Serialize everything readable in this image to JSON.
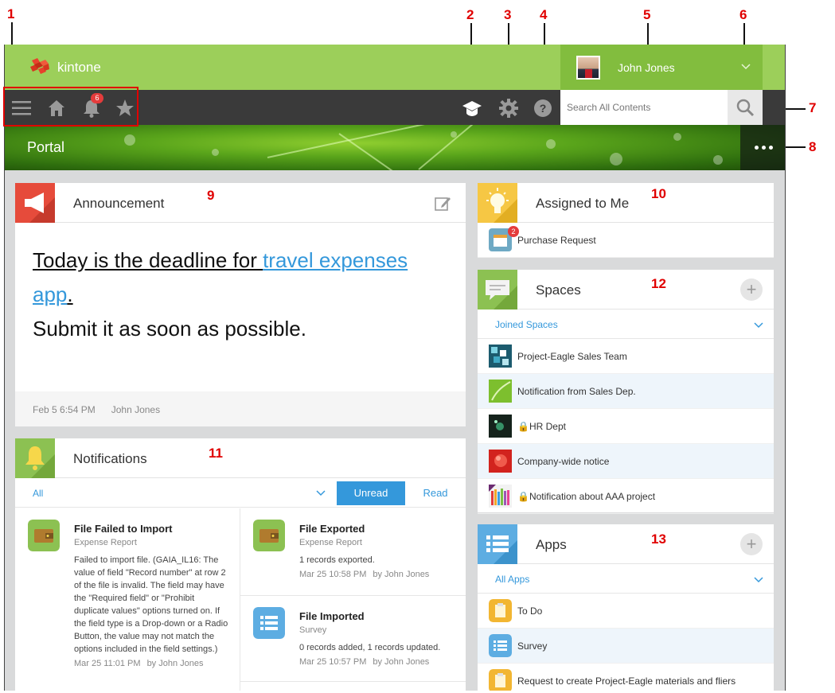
{
  "callouts": [
    "1",
    "2",
    "3",
    "4",
    "5",
    "6",
    "7",
    "8",
    "9",
    "10",
    "11",
    "12",
    "13"
  ],
  "header": {
    "logo_text": "kintone",
    "user_name": "John Jones",
    "notification_count": "6",
    "search_placeholder": "Search All Contents",
    "brand_green": "#9ccf5a",
    "toolbar_dark": "#3a3a3a"
  },
  "banner": {
    "title": "Portal"
  },
  "announcement": {
    "title": "Announcement",
    "text_part1": "Today is the deadline for ",
    "link_text": "travel expenses app",
    "text_part2": ".",
    "line2": "Submit it as soon as possible.",
    "date": "Feb 5 6:54 PM",
    "author": "John Jones"
  },
  "notifications": {
    "title": "Notifications",
    "filter": "All",
    "unread_label": "Unread",
    "read_label": "Read",
    "items": [
      {
        "title": "File Failed to Import",
        "app": "Expense Report",
        "body": "Failed to import file. (GAIA_IL16: The value of field \"Record number\" at row 2 of the file is invalid. The field may have the \"Required field\" or \"Prohibit duplicate values\" options turned on. If the field type is a Drop-down or a Radio Button, the value may not match the options included in the field settings.)",
        "date": "Mar 25 11:01 PM",
        "by": "by John Jones"
      },
      {
        "title": "File Exported",
        "app": "Expense Report",
        "body": "1 records exported.",
        "date": "Mar 25 10:58 PM",
        "by": "by John Jones"
      },
      {
        "title": "File Imported",
        "app": "Survey",
        "body": "0 records added, 1 records updated.",
        "date": "Mar 25 10:57 PM",
        "by": "by John Jones"
      }
    ]
  },
  "assigned": {
    "title": "Assigned to Me",
    "items": [
      {
        "label": "Purchase Request",
        "badge": "2"
      }
    ]
  },
  "spaces": {
    "title": "Spaces",
    "filter": "Joined Spaces",
    "items": [
      {
        "label": "Project-Eagle Sales Team"
      },
      {
        "label": "Notification from Sales Dep."
      },
      {
        "label": "HR Dept"
      },
      {
        "label": "Company-wide notice"
      },
      {
        "label": "Notification about AAA project"
      }
    ]
  },
  "apps": {
    "title": "Apps",
    "filter": "All Apps",
    "items": [
      {
        "label": "To Do"
      },
      {
        "label": "Survey"
      },
      {
        "label": "Request to create Project-Eagle materials and fliers"
      }
    ]
  }
}
